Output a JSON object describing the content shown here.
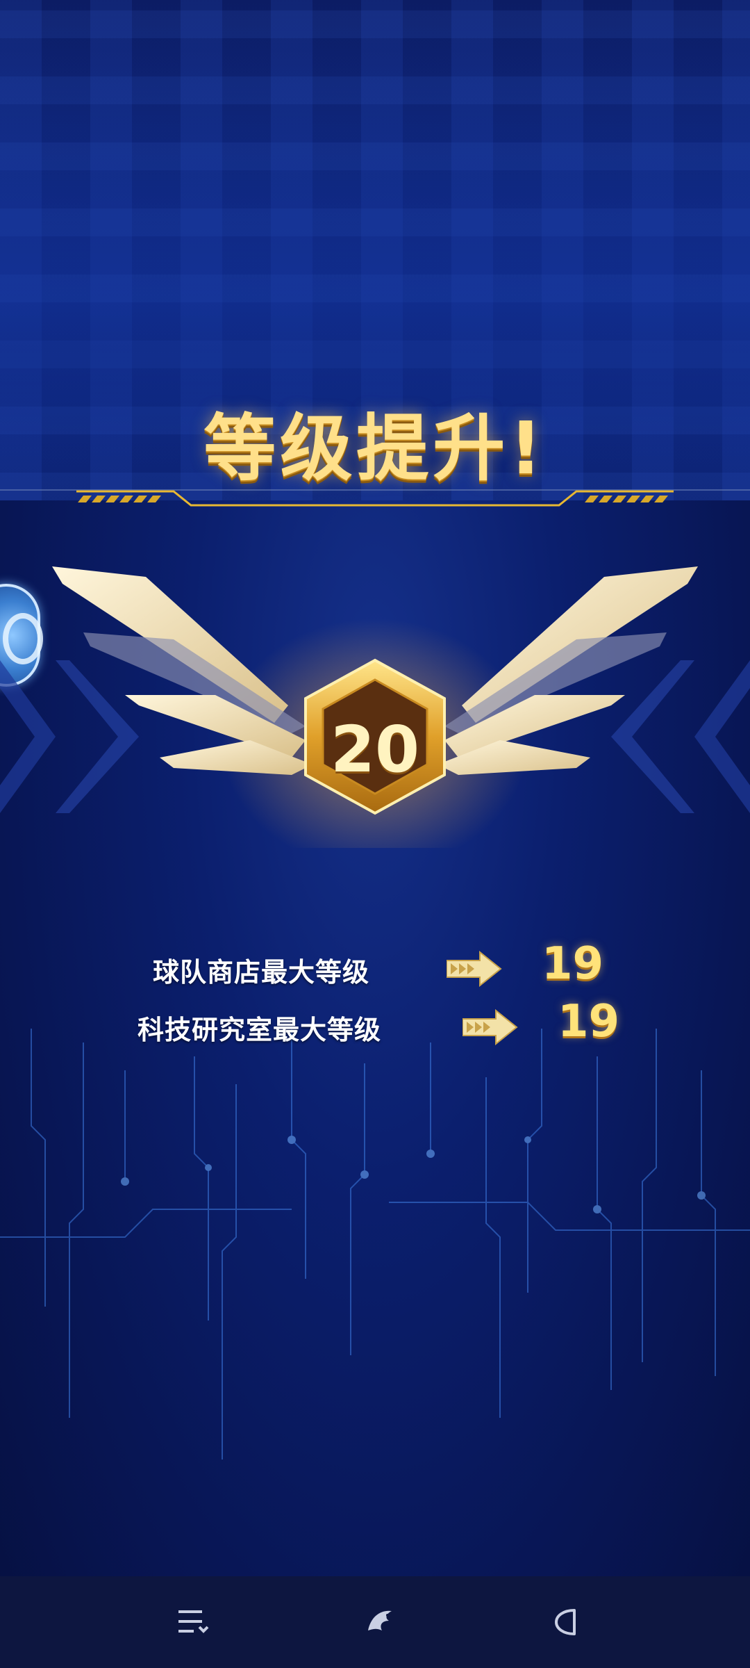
{
  "title": "等级提升!",
  "level": "20",
  "rows": [
    {
      "label": "球队商店最大等级",
      "value": "19"
    },
    {
      "label": "科技研究室最大等级",
      "value": "19"
    }
  ],
  "icons": {
    "float": "circle-ring-icon",
    "nav_menu": "menu-icon",
    "nav_home": "dragon-logo-icon",
    "nav_back": "back-icon"
  },
  "colors": {
    "accent_gold": "#ffe08a",
    "background": "#0b1f6e",
    "navbar": "#0d1640"
  }
}
